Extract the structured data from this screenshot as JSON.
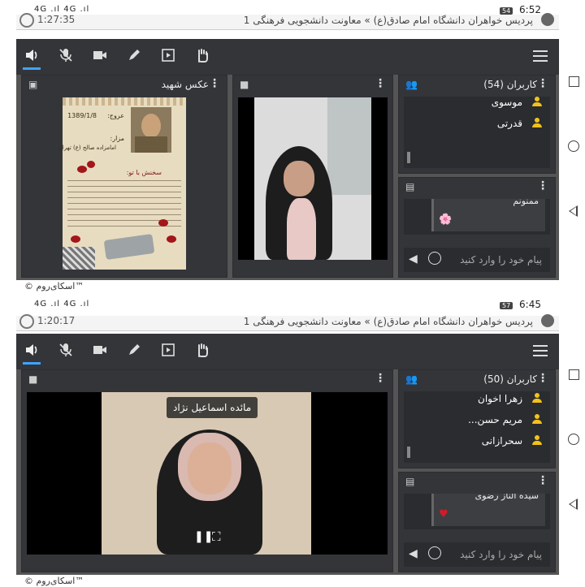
{
  "screens": [
    {
      "status": {
        "left": "4G .ıl  4G .ıl",
        "battery": "54",
        "time": "6:52"
      },
      "title": "پردیس خواهران دانشگاه امام صادق(ع) » معاونت دانشجویی فرهنگی 1",
      "timer": "1:27:35",
      "toolbar": [
        "speaker-icon",
        "mic-off-icon",
        "camera-icon",
        "pen-icon",
        "play-box-icon",
        "hand-icon"
      ],
      "panels": {
        "media_title": "عکس شهید",
        "users_title": "کاربران (54)",
        "users": [
          "موسوی",
          "قدرتی"
        ],
        "chat_message": "ممنونم",
        "chat_emoji": "🌸",
        "chat_placeholder": "پیام خود را وارد کنید"
      },
      "poster": {
        "date": "1389/1/8",
        "date_label": "عروج:",
        "place_label": "مزار:",
        "place": "امامزاده صالح (ع) تهران",
        "subtitle": "سخنش با تو:"
      },
      "footer": "© اسکای‌روم™"
    },
    {
      "status": {
        "left": "4G .ıl  4G .ıl",
        "battery": "57",
        "time": "6:45"
      },
      "title": "پردیس خواهران دانشگاه امام صادق(ع) » معاونت دانشجویی فرهنگی 1",
      "timer": "1:20:17",
      "toolbar": [
        "speaker-icon",
        "mic-off-icon",
        "camera-icon",
        "pen-icon",
        "play-box-icon",
        "hand-icon"
      ],
      "panels": {
        "users_title": "کاربران (50)",
        "users": [
          "زهرا اخوان",
          "مریم حسن...",
          "سحرازانی"
        ],
        "chat_message": "سیده الناز رضوی",
        "chat_emoji": "♥",
        "chat_placeholder": "پیام خود را وارد کنید",
        "speaker_name": "مائده اسماعیل نژاد"
      },
      "footer": "© اسکای‌روم™"
    }
  ],
  "colors": {
    "toolbar": "#333539",
    "accent": "#3fa3ff",
    "user_icon": "#f2c21b",
    "heart": "#d11b2a"
  }
}
